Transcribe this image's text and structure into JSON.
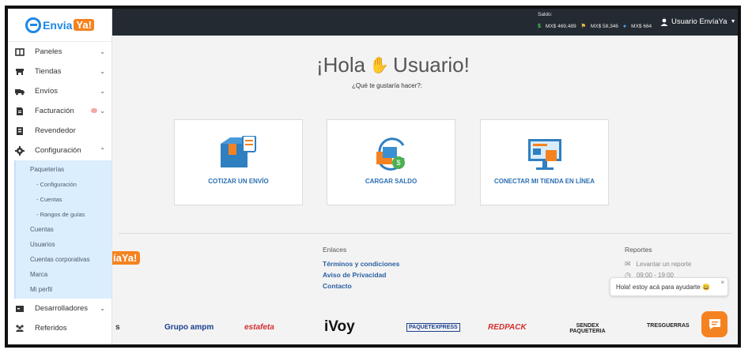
{
  "brand": {
    "name_left": "Envia",
    "name_right": "Ya!"
  },
  "sidebar": {
    "items": [
      {
        "label": "Paneles",
        "icon": "panels-icon",
        "chevron": "down"
      },
      {
        "label": "Tiendas",
        "icon": "store-icon",
        "chevron": "down"
      },
      {
        "label": "Envíos",
        "icon": "truck-icon",
        "chevron": "down"
      },
      {
        "label": "Facturación",
        "icon": "invoice-icon",
        "chevron": "down"
      },
      {
        "label": "Revendedor",
        "icon": "reseller-icon"
      },
      {
        "label": "Configuración",
        "icon": "gear-icon",
        "chevron": "up"
      }
    ],
    "config_submenu": [
      {
        "label": "Paqueterías"
      },
      {
        "label": "- Configuración"
      },
      {
        "label": "- Cuentas"
      },
      {
        "label": "- Rangos de guías"
      },
      {
        "label": "Cuentas"
      },
      {
        "label": "Usuarios"
      },
      {
        "label": "Cuentas corporativas"
      },
      {
        "label": "Marca"
      },
      {
        "label": "Mi perfil"
      }
    ],
    "bottom_items": [
      {
        "label": "Desarrolladores",
        "icon": "developer-icon",
        "chevron": "down"
      },
      {
        "label": "Referidos",
        "icon": "referrals-icon"
      }
    ]
  },
  "topbar": {
    "saldo_label": "Saldo:",
    "balances": [
      {
        "symbol": "$",
        "value": "MX$ 469,489",
        "color": "#3ecf5a"
      },
      {
        "symbol": "⚑",
        "value": "MX$ 58,346",
        "color": "#f5c242"
      },
      {
        "symbol": "●",
        "value": "MX$ 664",
        "color": "#4aa3ff"
      }
    ],
    "user_name": "Usuario EnvíaYa"
  },
  "main": {
    "greeting_left": "¡Hola",
    "greeting_right": "Usuario!",
    "subtitle": "¿Qué te gustaría hacer?:",
    "cards": [
      {
        "label": "COTIZAR UN ENVÍO",
        "icon": "quote-shipment-icon"
      },
      {
        "label": "CARGAR SALDO",
        "icon": "load-balance-icon"
      },
      {
        "label": "CONECTAR MI TIENDA EN LÍNEA",
        "icon": "connect-store-icon"
      }
    ]
  },
  "footer": {
    "logo_text": "íaYa!",
    "links_title": "Enlaces",
    "links": [
      "Términos y condiciones",
      "Aviso de Privacidad",
      "Contacto"
    ],
    "reports_title": "Reportes",
    "report_action": "Levantar un reporte",
    "hours": "09:00 - 19:00",
    "carriers": [
      "s",
      "Grupo ampm",
      "estafeta",
      "iVoy",
      "PAQUETEXPRESS",
      "REDPACK",
      "SENDEX PAQUETERIA",
      "TRESGUERRAS"
    ]
  },
  "chat": {
    "message": "Hola! estoy acá para ayudarte 😀",
    "close": "×"
  },
  "colors": {
    "accent": "#f58220",
    "brand_blue": "#1e88e5",
    "topbar": "#242a31",
    "link": "#2b5fa3"
  }
}
